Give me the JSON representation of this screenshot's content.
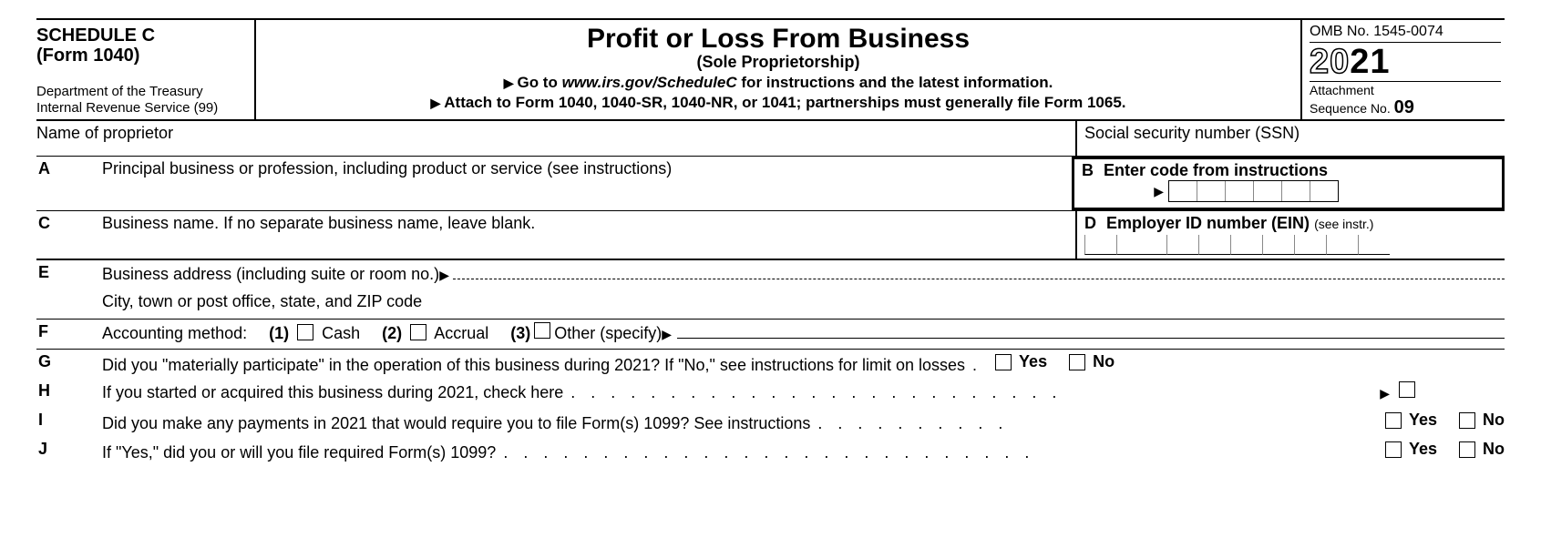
{
  "header": {
    "schedule": "SCHEDULE C",
    "form": "(Form 1040)",
    "dept1": "Department of the Treasury",
    "dept2": "Internal Revenue Service (99)",
    "title": "Profit or Loss From Business",
    "subtitle": "(Sole Proprietorship)",
    "goto_pre": "Go to ",
    "goto_url": "www.irs.gov/ScheduleC",
    "goto_post": " for instructions and the latest information.",
    "attach": "Attach to Form 1040, 1040-SR, 1040-NR, or 1041; partnerships must generally file Form 1065.",
    "omb": "OMB No. 1545-0074",
    "year_outline": "20",
    "year_bold": "21",
    "attach_label": "Attachment",
    "seq_label": "Sequence No. ",
    "seq_no": "09"
  },
  "proprietor": {
    "name_label": "Name of proprietor",
    "ssn_label": "Social security number (SSN)"
  },
  "lines": {
    "A": {
      "letter": "A",
      "text": "Principal business or profession, including product or service (see instructions)"
    },
    "B": {
      "letter": "B",
      "text": "Enter code from instructions"
    },
    "C": {
      "letter": "C",
      "text": "Business name. If no separate business name, leave blank."
    },
    "D": {
      "letter": "D",
      "text": "Employer ID number (EIN) ",
      "small": "(see instr.)"
    },
    "E": {
      "letter": "E",
      "text1": "Business address (including suite or room no.)",
      "text2": "City, town or post office, state, and ZIP code"
    },
    "F": {
      "letter": "F",
      "label": "Accounting method:",
      "opt1_num": "(1)",
      "opt1": "Cash",
      "opt2_num": "(2)",
      "opt2": "Accrual",
      "opt3_num": "(3)",
      "opt3": "Other (specify)"
    },
    "G": {
      "letter": "G",
      "text": "Did you \"materially participate\" in the operation of this business during 2021? If \"No,\" see instructions for limit on losses"
    },
    "H": {
      "letter": "H",
      "text": "If you started or acquired this business during 2021, check here"
    },
    "I": {
      "letter": "I",
      "text": "Did you make any payments in 2021 that would require you to file Form(s) 1099? See instructions"
    },
    "J": {
      "letter": "J",
      "text": "If \"Yes,\" did you or will you file required Form(s) 1099?"
    }
  },
  "yn": {
    "yes": "Yes",
    "no": "No"
  }
}
